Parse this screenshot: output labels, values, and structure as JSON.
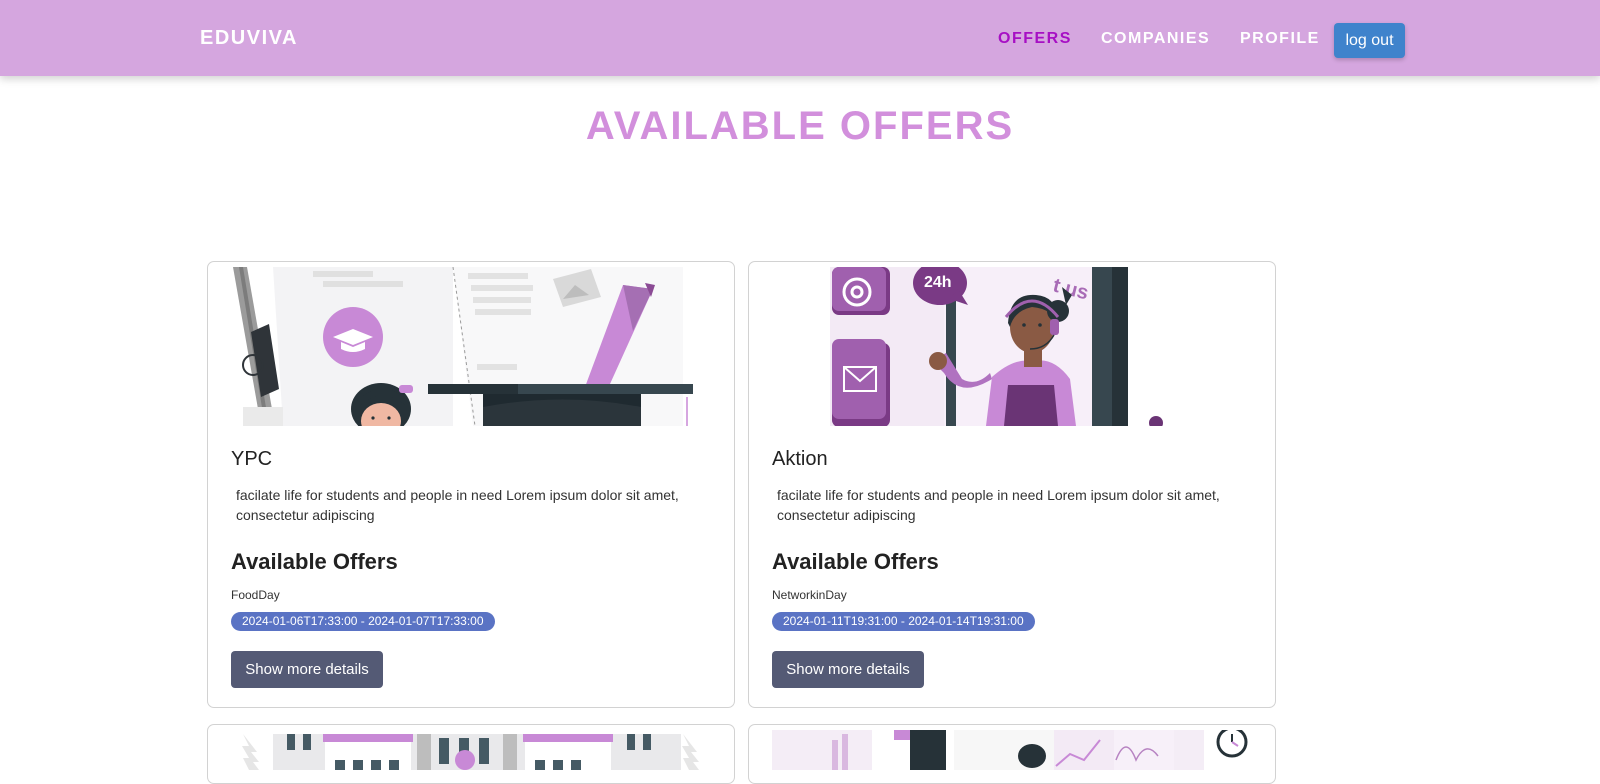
{
  "navbar": {
    "brand": "EDUVIVA",
    "links": [
      {
        "label": "OFFERS",
        "active": true
      },
      {
        "label": "COMPANIES",
        "active": false
      },
      {
        "label": "PROFILE",
        "active": false
      }
    ],
    "logout_label": "log out"
  },
  "page": {
    "title": "AVAILABLE OFFERS"
  },
  "cards": [
    {
      "title": "YPC",
      "description": "facilate life for students and people in need Lorem ipsum dolor sit amet, consectetur adipiscing",
      "offers_heading": "Available Offers",
      "offer_name": "FoodDay",
      "offer_dates": "2024-01-06T17:33:00 - 2024-01-07T17:33:00",
      "button_label": "Show more details"
    },
    {
      "title": "Aktion",
      "description": "facilate life for students and people in need Lorem ipsum dolor sit amet, consectetur adipiscing",
      "offers_heading": "Available Offers",
      "offer_name": "NetworkinDay",
      "offer_dates": "2024-01-11T19:31:00 - 2024-01-14T19:31:00",
      "button_label": "Show more details"
    }
  ],
  "colors": {
    "navbar_bg": "#d5a6df",
    "active_link": "#a70fc4",
    "title": "#d28fdc",
    "logout_button": "#3f83cc",
    "date_badge": "#5a73c4",
    "details_button": "#545a75"
  }
}
